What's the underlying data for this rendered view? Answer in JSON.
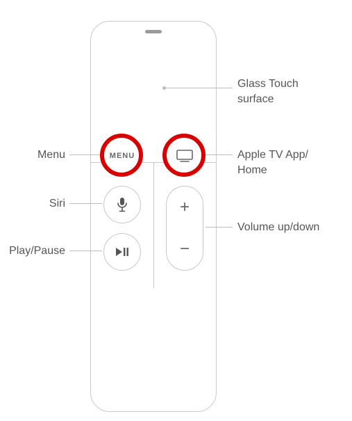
{
  "labels": {
    "glass_touch": "Glass Touch surface",
    "menu": "Menu",
    "tv_home": "Apple TV App/\nHome",
    "siri": "Siri",
    "volume": "Volume up/down",
    "play_pause": "Play/Pause"
  },
  "buttons": {
    "menu_text": "MENU"
  },
  "highlight_color": "#d90000"
}
